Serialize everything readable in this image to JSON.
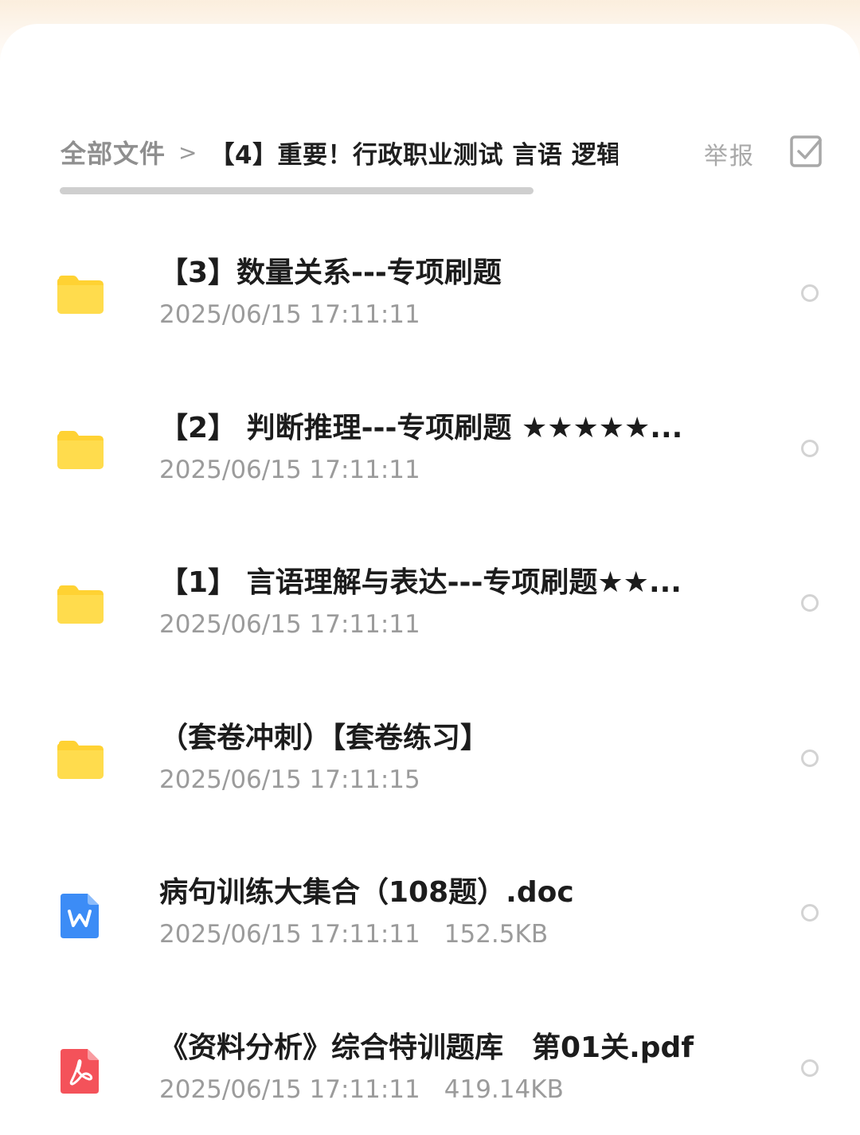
{
  "breadcrumb": {
    "root": "全部文件",
    "separator": ">",
    "current": "【4】重要！行政职业测试 言语 逻辑"
  },
  "actions": {
    "report_label": "举报",
    "multi_select_icon": "checkbox-square-icon"
  },
  "colors": {
    "folder": "#ffd233",
    "word": "#3c8cf6",
    "pdf": "#f4525a",
    "title_text": "#1c1c1c",
    "meta_text": "#9b9b9b"
  },
  "files": [
    {
      "type": "folder",
      "icon": "folder-icon",
      "name": "【3】数量关系---专项刷题",
      "modified": "2025/06/15 17:11:11",
      "size": ""
    },
    {
      "type": "folder",
      "icon": "folder-icon",
      "name": "【2】 判断推理---专项刷题 ★★★★★...",
      "modified": "2025/06/15 17:11:11",
      "size": ""
    },
    {
      "type": "folder",
      "icon": "folder-icon",
      "name": "【1】 言语理解与表达---专项刷题★★...",
      "modified": "2025/06/15 17:11:11",
      "size": ""
    },
    {
      "type": "folder",
      "icon": "folder-icon",
      "name": "（套卷冲刺）【套卷练习】",
      "modified": "2025/06/15 17:11:15",
      "size": ""
    },
    {
      "type": "doc",
      "icon": "word-doc-icon",
      "name": "病句训练大集合（108题）.doc",
      "modified": "2025/06/15 17:11:11",
      "size": "152.5KB"
    },
    {
      "type": "pdf",
      "icon": "pdf-icon",
      "name": "《资料分析》综合特训题库　第01关.pdf",
      "modified": "2025/06/15 17:11:11",
      "size": "419.14KB"
    }
  ]
}
